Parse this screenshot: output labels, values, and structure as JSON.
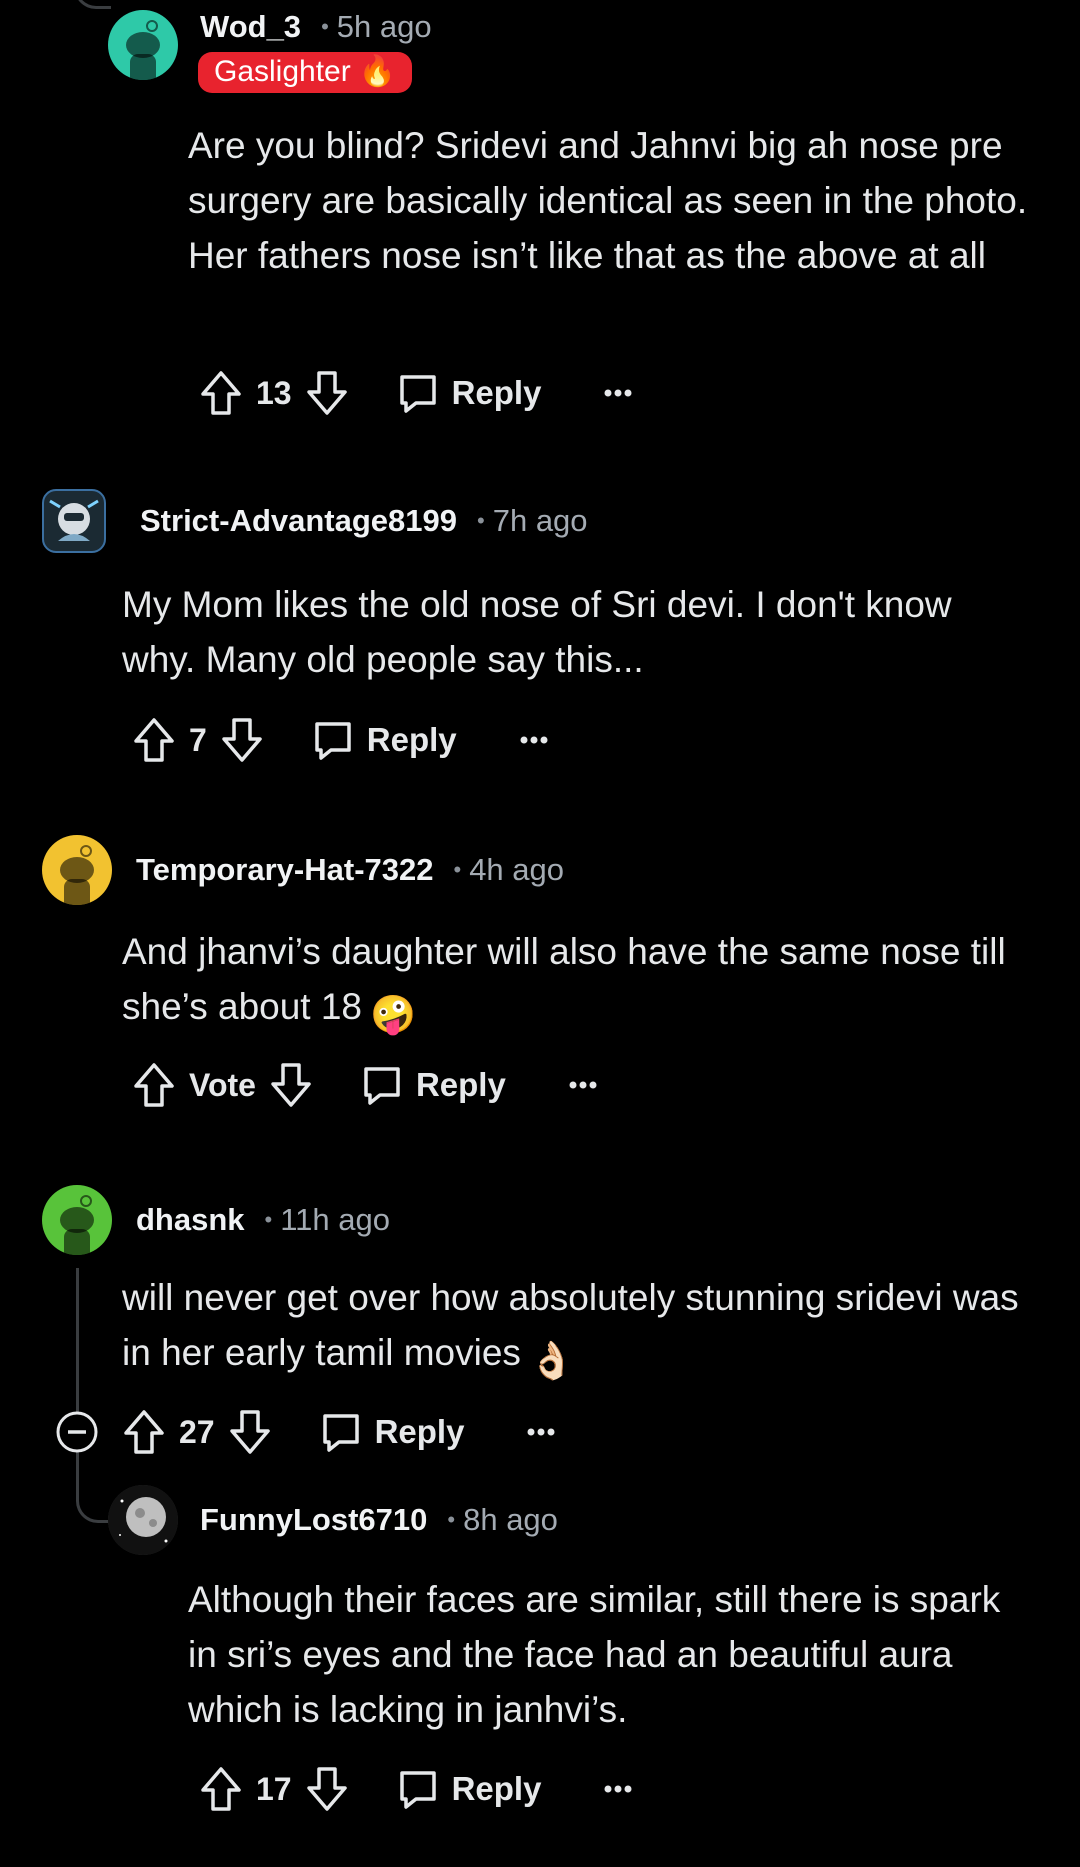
{
  "colors": {
    "background": "#000000",
    "thread_line": "#3a3d40",
    "flair_red": "#e8232e",
    "avatar_teal": "#2ec9a8",
    "avatar_yellow": "#f2c230",
    "avatar_green": "#58c33a"
  },
  "comments": [
    {
      "username": "Wod_3",
      "time": "5h ago",
      "flair": "Gaslighter",
      "flair_emoji": "🔥",
      "body": "Are you blind? Sridevi and Jahnvi big ah nose pre surgery are basically identical as seen in the photo. Her fathers nose isn’t like that as the above at all",
      "votes": "13",
      "reply_label": "Reply",
      "avatar_icon": "snoo-avatar-icon"
    },
    {
      "username": "Strict-Advantage8199",
      "time": "7h ago",
      "body": "My Mom likes the old nose of Sri devi. I don't know why. Many old people say this...",
      "votes": "7",
      "reply_label": "Reply",
      "avatar_icon": "custom-avatar-icon"
    },
    {
      "username": "Temporary-Hat-7322",
      "time": "4h ago",
      "body": "And jhanvi’s daughter will also have the same nose till she’s about 18",
      "emoji": "🤪",
      "votes": "Vote",
      "reply_label": "Reply",
      "avatar_icon": "snoo-avatar-icon"
    },
    {
      "username": "dhasnk",
      "time": "11h ago",
      "body": "will never get over how absolutely stunning sridevi was in her early tamil movies",
      "emoji": "👌🏻",
      "votes": "27",
      "reply_label": "Reply",
      "avatar_icon": "snoo-avatar-icon"
    },
    {
      "username": "FunnyLost6710",
      "time": "8h ago",
      "body": "Although their faces are similar, still there is spark in sri’s eyes and the face had an beautiful aura which is lacking in janhvi’s.",
      "votes": "17",
      "reply_label": "Reply",
      "avatar_icon": "moon-avatar-icon"
    }
  ]
}
